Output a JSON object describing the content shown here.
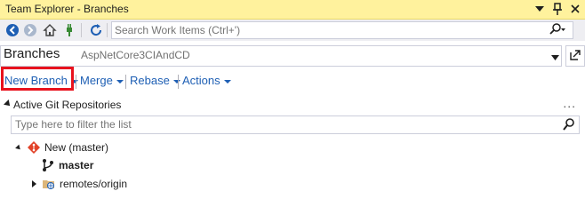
{
  "window": {
    "title": "Team Explorer - Branches",
    "title_bg": "#fff29d"
  },
  "toolbar": {
    "buttons": [
      "back-icon",
      "forward-icon",
      "home-icon",
      "connect-icon",
      "refresh-icon"
    ],
    "search_placeholder": "Search Work Items (Ctrl+')"
  },
  "page": {
    "title": "Branches",
    "subtitle": "AspNetCore3CIAndCD"
  },
  "actions": [
    {
      "label": "New Branch",
      "highlighted": true
    },
    {
      "label": "Merge"
    },
    {
      "label": "Rebase"
    },
    {
      "label": "Actions"
    }
  ],
  "section": {
    "title": "Active Git Repositories",
    "more_label": "..."
  },
  "filter": {
    "placeholder": "Type here to filter the list"
  },
  "tree": {
    "repo": "New (master)",
    "branch": "master",
    "remote": "remotes/origin"
  },
  "colors": {
    "accent_link": "#1e5fb4",
    "highlight_border": "#e8121d",
    "git_icon": "#e24329"
  }
}
